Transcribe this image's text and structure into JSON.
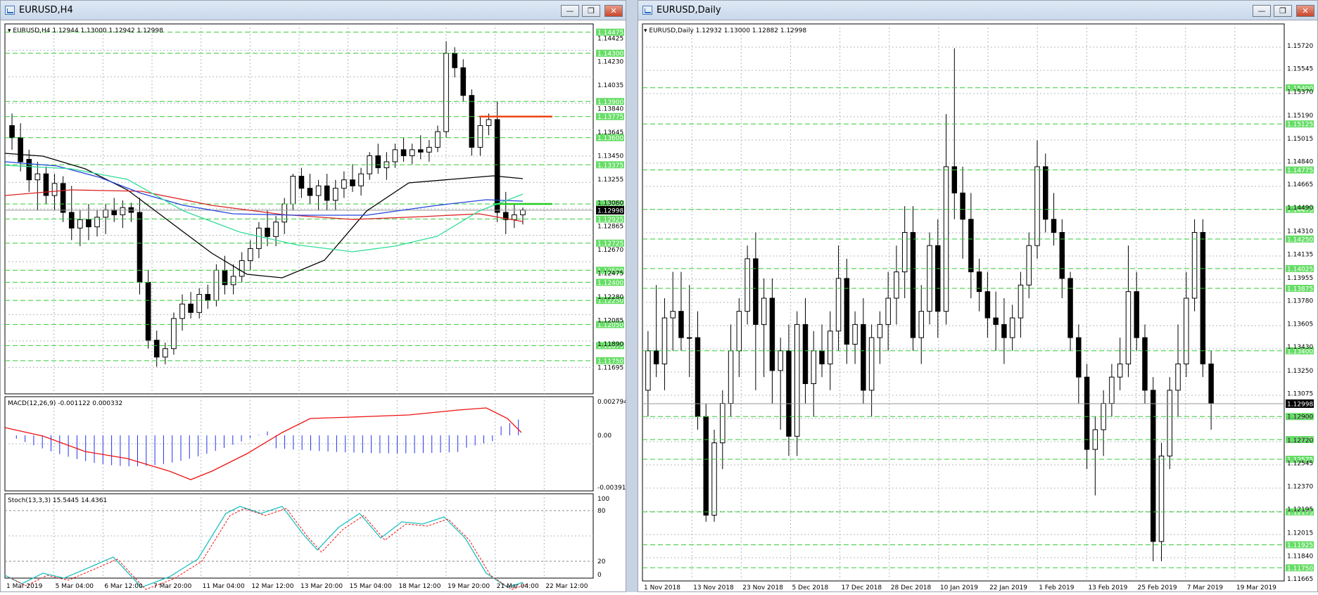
{
  "left_window": {
    "title": "EURUSD,H4",
    "buttons": [
      "—",
      "❐",
      "✕"
    ],
    "header": "EURUSD,H4  1.12944 1.13000 1.12942 1.12998",
    "price_axis": [
      "1.14425",
      "1.14230",
      "1.14035",
      "1.13840",
      "1.13645",
      "1.13450",
      "1.13255",
      "1.13060",
      "1.12865",
      "1.12670",
      "1.12475",
      "1.12280",
      "1.12085",
      "1.11890",
      "1.11695"
    ],
    "level_labels": [
      "1.14475",
      "1.14300",
      "1.13900",
      "1.13775",
      "1.13600",
      "1.13375",
      "1.13050",
      "1.12925",
      "1.12725",
      "1.12500",
      "1.12400",
      "1.12250",
      "1.12050",
      "1.11875",
      "1.11750"
    ],
    "current_price": "1.12998",
    "macd_header": "MACD(12,26,9) -0.001122 0.000332",
    "macd_axis": [
      "0.002794",
      "0.00",
      "-0.003912"
    ],
    "stoch_header": "Stoch(13,3,3) 15.5445 14.4361",
    "stoch_axis": [
      "100",
      "80",
      "20",
      "0"
    ],
    "time_axis": [
      "1 Mar 2019",
      "5 Mar 04:00",
      "6 Mar 12:00",
      "7 Mar 20:00",
      "11 Mar 04:00",
      "12 Mar 12:00",
      "13 Mar 20:00",
      "15 Mar 04:00",
      "18 Mar 12:00",
      "19 Mar 20:00",
      "21 Mar 04:00",
      "22 Mar 12:00"
    ]
  },
  "right_window": {
    "title": "EURUSD,Daily",
    "buttons": [
      "—",
      "❐",
      "✕"
    ],
    "header": "EURUSD,Daily  1.12932 1.13000 1.12882 1.12998",
    "price_axis": [
      "1.15720",
      "1.15545",
      "1.15370",
      "1.15190",
      "1.15015",
      "1.14840",
      "1.14665",
      "1.14490",
      "1.14310",
      "1.14135",
      "1.13955",
      "1.13780",
      "1.13605",
      "1.13430",
      "1.13250",
      "1.13075",
      "1.12900",
      "1.12720",
      "1.12545",
      "1.12370",
      "1.12195",
      "1.12015",
      "1.11840",
      "1.11665"
    ],
    "level_labels": [
      "1.15400",
      "1.15125",
      "1.14775",
      "1.14475",
      "1.14250",
      "1.14025",
      "1.13875",
      "1.13400",
      "1.12900",
      "1.12725",
      "1.12575",
      "1.12175",
      "1.11925",
      "1.11750"
    ],
    "current_price": "1.12998",
    "time_axis": [
      "1 Nov 2018",
      "13 Nov 2018",
      "23 Nov 2018",
      "5 Dec 2018",
      "17 Dec 2018",
      "28 Dec 2018",
      "10 Jan 2019",
      "22 Jan 2019",
      "1 Feb 2019",
      "13 Feb 2019",
      "25 Feb 2019",
      "7 Mar 2019",
      "19 Mar 2019"
    ]
  },
  "colors": {
    "level_line": "#33cc33",
    "level_label_bg": "#66dd66",
    "grid": "#b0b8c0",
    "macd_histogram": "#2233ee",
    "macd_signal": "#ee1111",
    "stoch_main": "#20c0c0",
    "stoch_signal": "#ee1111",
    "ma_black": "#000000",
    "ma_red": "#dd2222",
    "ma_blue": "#2244dd",
    "ma_green": "#33dd99",
    "resistance": "#ee4411",
    "support": "#22cc22"
  },
  "chart_data": [
    {
      "type": "candlestick",
      "title": "EURUSD,H4",
      "ylim": [
        1.1165,
        1.1445
      ],
      "ohlc": [
        [
          1.137,
          1.138,
          1.135,
          1.136
        ],
        [
          1.136,
          1.1372,
          1.1332,
          1.134
        ],
        [
          1.1342,
          1.135,
          1.1315,
          1.1325
        ],
        [
          1.1325,
          1.134,
          1.13,
          1.133
        ],
        [
          1.133,
          1.1336,
          1.1305,
          1.1312
        ],
        [
          1.1312,
          1.133,
          1.13,
          1.1322
        ],
        [
          1.1322,
          1.1328,
          1.129,
          1.1298
        ],
        [
          1.1298,
          1.132,
          1.1275,
          1.1285
        ],
        [
          1.1285,
          1.13,
          1.127,
          1.1292
        ],
        [
          1.1292,
          1.1305,
          1.1275,
          1.1286
        ],
        [
          1.1286,
          1.13,
          1.1278,
          1.1294
        ],
        [
          1.1294,
          1.1305,
          1.128,
          1.13
        ],
        [
          1.13,
          1.131,
          1.129,
          1.1296
        ],
        [
          1.1296,
          1.1308,
          1.1285,
          1.1302
        ],
        [
          1.1302,
          1.1306,
          1.129,
          1.1298
        ],
        [
          1.1298,
          1.131,
          1.123,
          1.124
        ],
        [
          1.124,
          1.125,
          1.1185,
          1.1192
        ],
        [
          1.1192,
          1.12,
          1.117,
          1.1178
        ],
        [
          1.1178,
          1.119,
          1.1172,
          1.1185
        ],
        [
          1.1185,
          1.1215,
          1.118,
          1.121
        ],
        [
          1.121,
          1.123,
          1.12,
          1.1222
        ],
        [
          1.1222,
          1.1232,
          1.121,
          1.1215
        ],
        [
          1.1215,
          1.1235,
          1.121,
          1.123
        ],
        [
          1.123,
          1.1238,
          1.1218,
          1.1225
        ],
        [
          1.1225,
          1.1255,
          1.122,
          1.125
        ],
        [
          1.125,
          1.1262,
          1.123,
          1.1238
        ],
        [
          1.1238,
          1.1255,
          1.123,
          1.1245
        ],
        [
          1.1245,
          1.1265,
          1.124,
          1.1258
        ],
        [
          1.1258,
          1.1275,
          1.125,
          1.1268
        ],
        [
          1.1268,
          1.129,
          1.126,
          1.1285
        ],
        [
          1.1285,
          1.13,
          1.127,
          1.1278
        ],
        [
          1.1278,
          1.1295,
          1.127,
          1.129
        ],
        [
          1.129,
          1.131,
          1.128,
          1.1305
        ],
        [
          1.1305,
          1.133,
          1.13,
          1.1328
        ],
        [
          1.1328,
          1.1335,
          1.131,
          1.1318
        ],
        [
          1.1318,
          1.133,
          1.1305,
          1.1312
        ],
        [
          1.1312,
          1.1325,
          1.13,
          1.132
        ],
        [
          1.132,
          1.133,
          1.13,
          1.1308
        ],
        [
          1.1308,
          1.1325,
          1.13,
          1.1318
        ],
        [
          1.1318,
          1.1332,
          1.131,
          1.1325
        ],
        [
          1.1325,
          1.1338,
          1.1315,
          1.132
        ],
        [
          1.132,
          1.1335,
          1.1312,
          1.133
        ],
        [
          1.133,
          1.1348,
          1.1325,
          1.1345
        ],
        [
          1.1345,
          1.1355,
          1.133,
          1.1335
        ],
        [
          1.1335,
          1.1348,
          1.1325,
          1.134
        ],
        [
          1.134,
          1.1355,
          1.1335,
          1.135
        ],
        [
          1.135,
          1.136,
          1.134,
          1.1345
        ],
        [
          1.1345,
          1.1355,
          1.1338,
          1.135
        ],
        [
          1.135,
          1.1362,
          1.1342,
          1.1348
        ],
        [
          1.1348,
          1.1358,
          1.134,
          1.1352
        ],
        [
          1.1352,
          1.137,
          1.1348,
          1.1365
        ],
        [
          1.1365,
          1.144,
          1.136,
          1.143
        ],
        [
          1.143,
          1.1435,
          1.141,
          1.1418
        ],
        [
          1.1418,
          1.1425,
          1.139,
          1.1395
        ],
        [
          1.1395,
          1.14,
          1.1345,
          1.1352
        ],
        [
          1.1352,
          1.1378,
          1.1345,
          1.137
        ],
        [
          1.137,
          1.138,
          1.1362,
          1.1375
        ],
        [
          1.1375,
          1.139,
          1.129,
          1.1298
        ],
        [
          1.1298,
          1.1315,
          1.128,
          1.1292
        ],
        [
          1.1292,
          1.1305,
          1.1285,
          1.1296
        ],
        [
          1.1296,
          1.1302,
          1.1288,
          1.13
        ]
      ]
    },
    {
      "type": "bar",
      "title": "MACD(12,26,9) -0.001122 0.000332",
      "ylim": [
        -0.003912,
        0.002794
      ]
    },
    {
      "type": "line",
      "title": "Stoch(13,3,3) 15.5445 14.4361",
      "ylim": [
        0,
        100
      ]
    },
    {
      "type": "candlestick",
      "title": "EURUSD,Daily",
      "ylim": [
        1.1165,
        1.158
      ],
      "ohlc": [
        [
          1.131,
          1.1355,
          1.129,
          1.134
        ],
        [
          1.134,
          1.139,
          1.132,
          1.133
        ],
        [
          1.133,
          1.138,
          1.131,
          1.1365
        ],
        [
          1.1365,
          1.14,
          1.134,
          1.137
        ],
        [
          1.137,
          1.14,
          1.134,
          1.135
        ],
        [
          1.135,
          1.139,
          1.132,
          1.135
        ],
        [
          1.135,
          1.137,
          1.128,
          1.129
        ],
        [
          1.129,
          1.13,
          1.121,
          1.1215
        ],
        [
          1.1215,
          1.128,
          1.121,
          1.127
        ],
        [
          1.127,
          1.131,
          1.125,
          1.13
        ],
        [
          1.13,
          1.136,
          1.129,
          1.134
        ],
        [
          1.134,
          1.138,
          1.132,
          1.137
        ],
        [
          1.137,
          1.142,
          1.136,
          1.141
        ],
        [
          1.141,
          1.143,
          1.131,
          1.136
        ],
        [
          1.136,
          1.1395,
          1.132,
          1.138
        ],
        [
          1.138,
          1.1395,
          1.13,
          1.1325
        ],
        [
          1.1325,
          1.135,
          1.128,
          1.134
        ],
        [
          1.134,
          1.136,
          1.126,
          1.1275
        ],
        [
          1.1275,
          1.137,
          1.126,
          1.136
        ],
        [
          1.136,
          1.138,
          1.13,
          1.1315
        ],
        [
          1.1315,
          1.1355,
          1.129,
          1.134
        ],
        [
          1.134,
          1.136,
          1.132,
          1.133
        ],
        [
          1.133,
          1.137,
          1.131,
          1.1355
        ],
        [
          1.1355,
          1.142,
          1.134,
          1.1395
        ],
        [
          1.1395,
          1.141,
          1.133,
          1.1345
        ],
        [
          1.1345,
          1.137,
          1.133,
          1.136
        ],
        [
          1.136,
          1.138,
          1.13,
          1.131
        ],
        [
          1.131,
          1.136,
          1.129,
          1.135
        ],
        [
          1.135,
          1.137,
          1.133,
          1.136
        ],
        [
          1.136,
          1.14,
          1.134,
          1.138
        ],
        [
          1.138,
          1.142,
          1.136,
          1.14
        ],
        [
          1.14,
          1.145,
          1.138,
          1.143
        ],
        [
          1.143,
          1.145,
          1.134,
          1.135
        ],
        [
          1.135,
          1.139,
          1.133,
          1.137
        ],
        [
          1.137,
          1.143,
          1.136,
          1.142
        ],
        [
          1.142,
          1.144,
          1.135,
          1.137
        ],
        [
          1.137,
          1.152,
          1.136,
          1.148
        ],
        [
          1.148,
          1.157,
          1.144,
          1.146
        ],
        [
          1.146,
          1.148,
          1.141,
          1.144
        ],
        [
          1.144,
          1.146,
          1.138,
          1.14
        ],
        [
          1.14,
          1.141,
          1.137,
          1.1385
        ],
        [
          1.1385,
          1.14,
          1.135,
          1.1365
        ],
        [
          1.1365,
          1.1385,
          1.134,
          1.136
        ],
        [
          1.136,
          1.138,
          1.133,
          1.135
        ],
        [
          1.135,
          1.1375,
          1.134,
          1.1365
        ],
        [
          1.1365,
          1.14,
          1.135,
          1.139
        ],
        [
          1.139,
          1.143,
          1.138,
          1.142
        ],
        [
          1.142,
          1.15,
          1.141,
          1.148
        ],
        [
          1.148,
          1.149,
          1.143,
          1.144
        ],
        [
          1.144,
          1.146,
          1.142,
          1.143
        ],
        [
          1.143,
          1.144,
          1.138,
          1.1395
        ],
        [
          1.1395,
          1.14,
          1.134,
          1.135
        ],
        [
          1.135,
          1.136,
          1.13,
          1.132
        ],
        [
          1.132,
          1.133,
          1.125,
          1.1265
        ],
        [
          1.1265,
          1.129,
          1.123,
          1.128
        ],
        [
          1.128,
          1.131,
          1.126,
          1.13
        ],
        [
          1.13,
          1.133,
          1.129,
          1.132
        ],
        [
          1.132,
          1.135,
          1.131,
          1.133
        ],
        [
          1.133,
          1.142,
          1.132,
          1.1385
        ],
        [
          1.1385,
          1.14,
          1.134,
          1.135
        ],
        [
          1.135,
          1.136,
          1.13,
          1.131
        ],
        [
          1.131,
          1.132,
          1.118,
          1.1195
        ],
        [
          1.1195,
          1.127,
          1.118,
          1.126
        ],
        [
          1.126,
          1.132,
          1.125,
          1.131
        ],
        [
          1.131,
          1.136,
          1.129,
          1.133
        ],
        [
          1.133,
          1.14,
          1.132,
          1.138
        ],
        [
          1.138,
          1.144,
          1.137,
          1.143
        ],
        [
          1.143,
          1.144,
          1.132,
          1.133
        ],
        [
          1.133,
          1.134,
          1.128,
          1.13
        ]
      ]
    }
  ]
}
